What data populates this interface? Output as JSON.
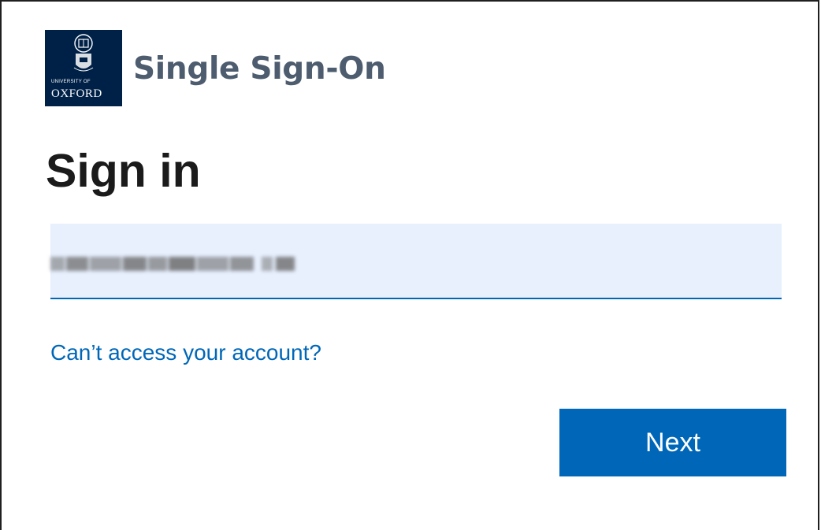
{
  "brand": {
    "logo_line1": "UNIVERSITY OF",
    "logo_line2": "OXFORD",
    "title": "Single Sign-On",
    "logo_color": "#002147"
  },
  "form": {
    "heading": "Sign in",
    "email_value": "",
    "email_obscured": true,
    "help_link": "Can’t access your account?",
    "next_label": "Next"
  },
  "colors": {
    "accent": "#0067b8",
    "input_bg": "#e8f0fe",
    "title_gray": "#4d5c6e"
  }
}
